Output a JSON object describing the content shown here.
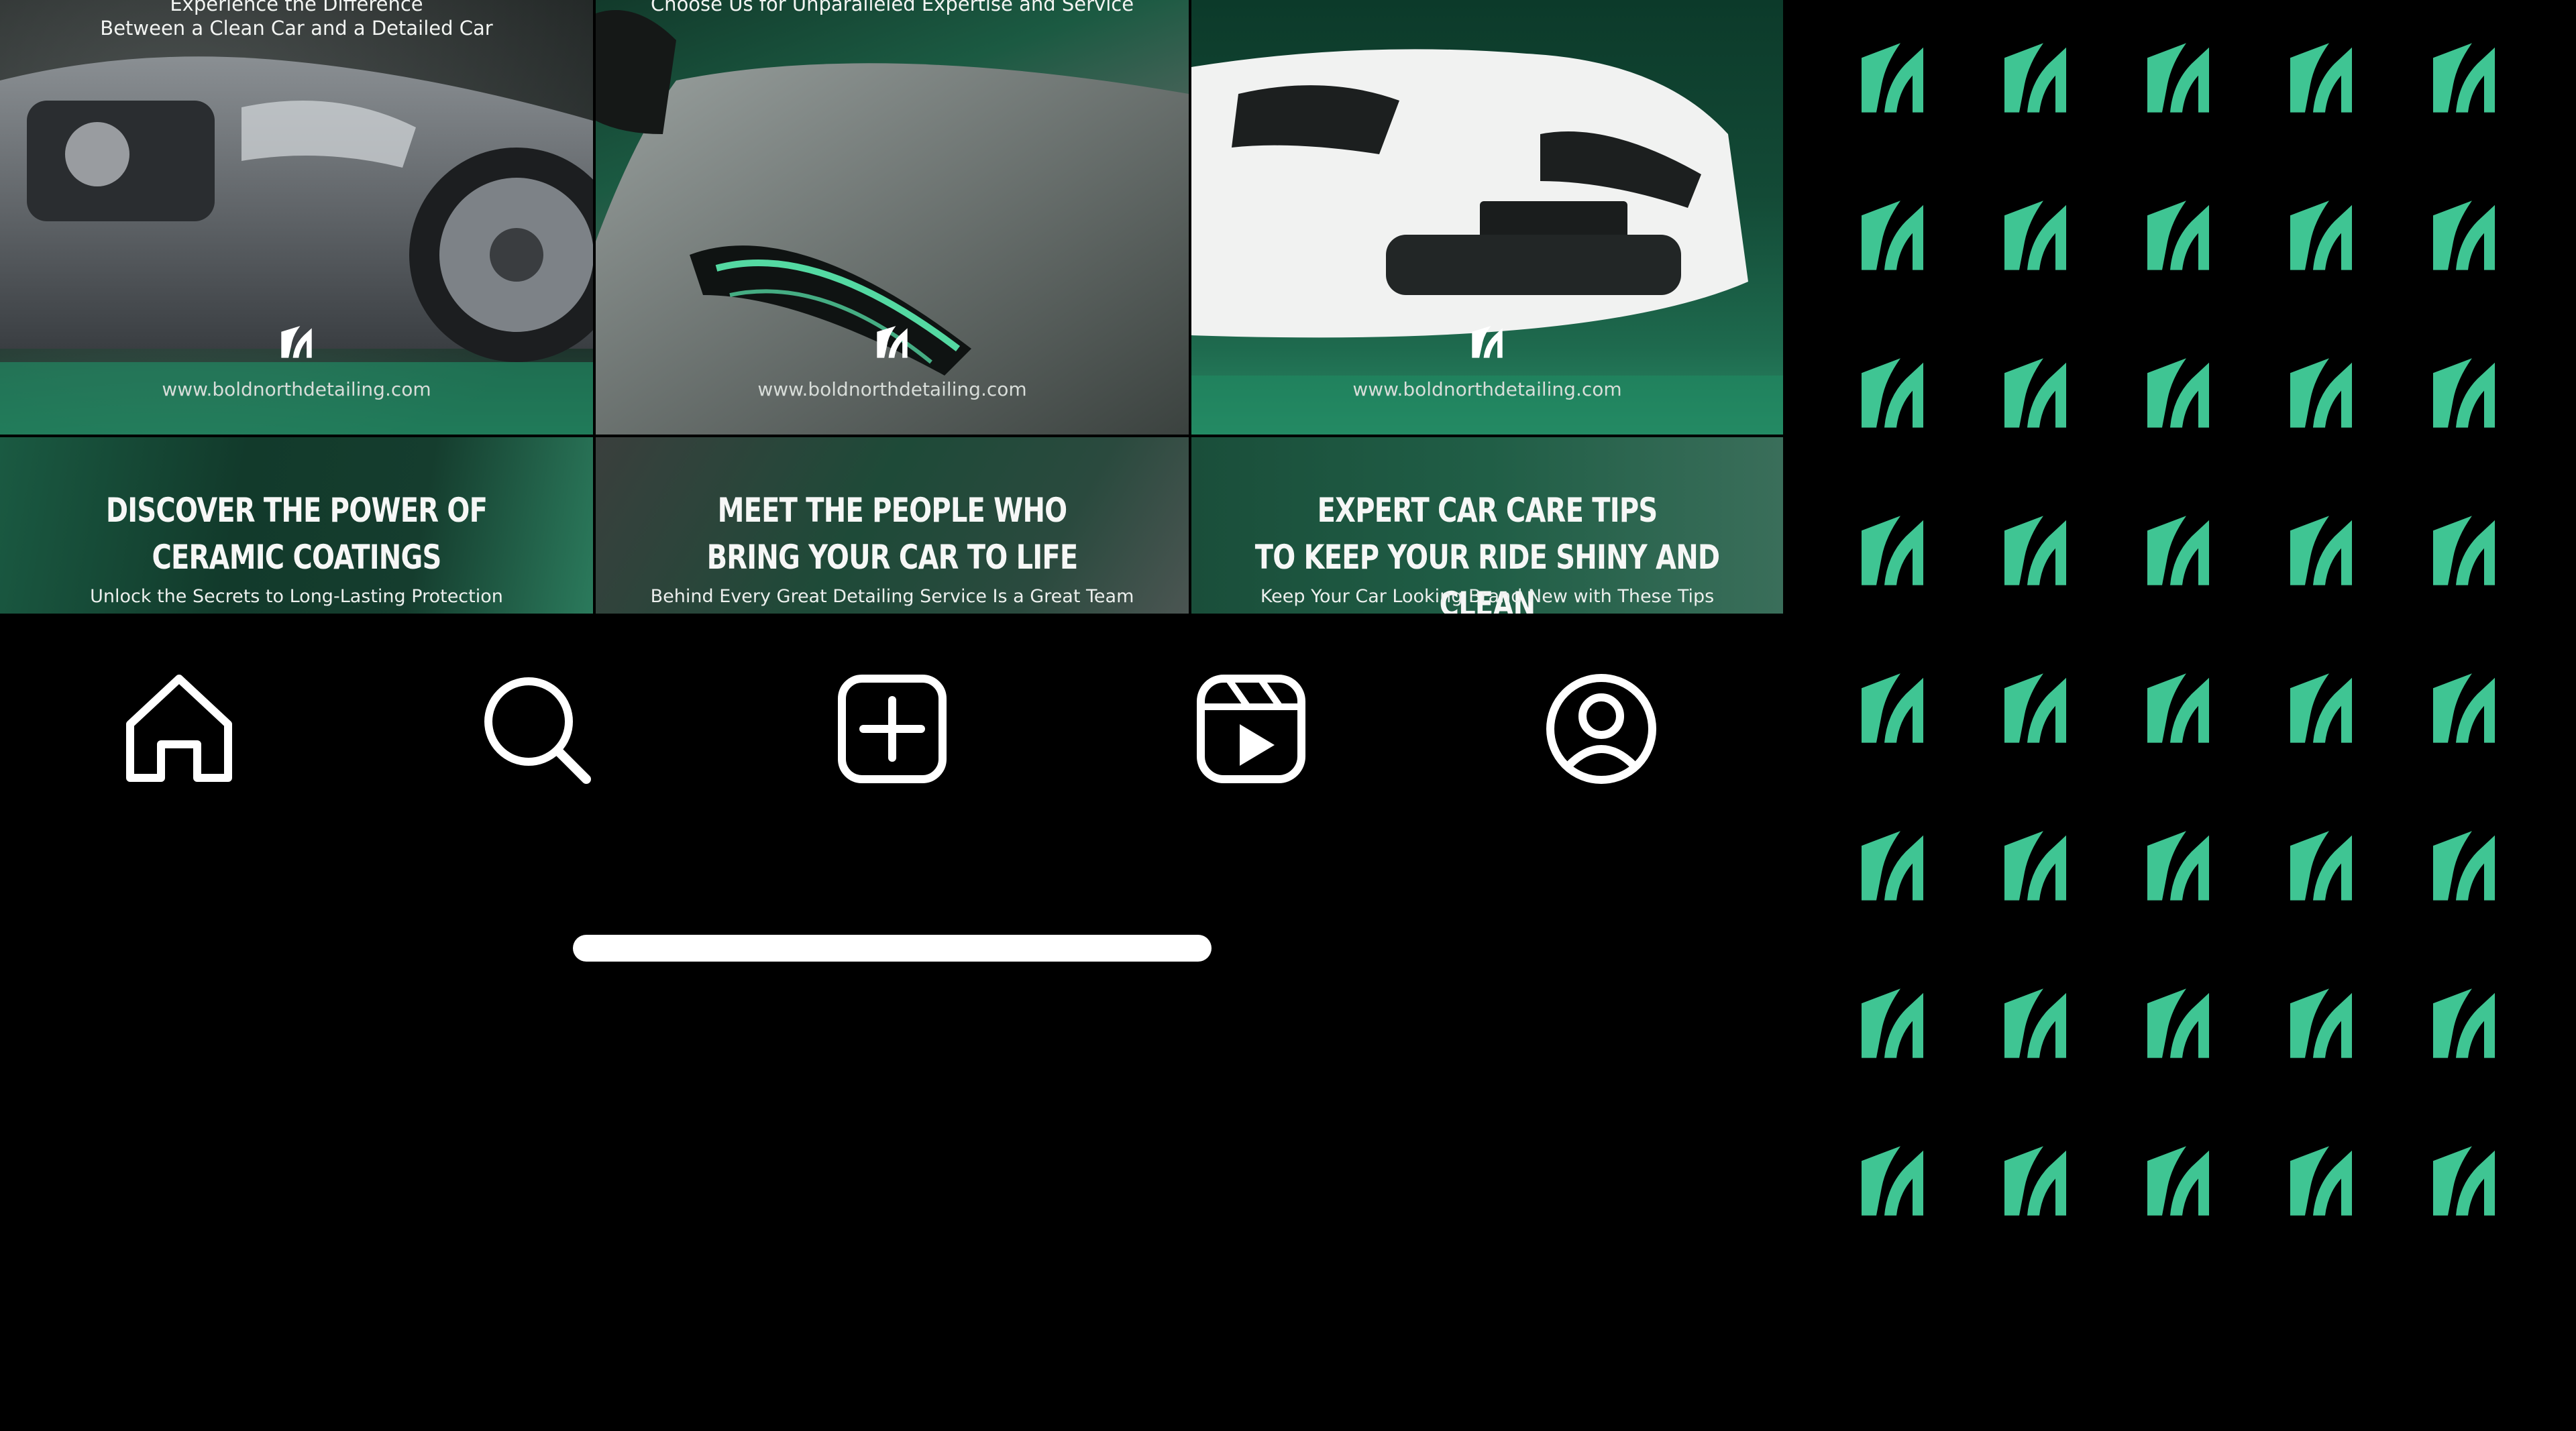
{
  "brand": {
    "accent": "#3fc593",
    "dark_green": "#123a2b",
    "background": "#000000"
  },
  "posts_row1": [
    {
      "top_text_1": "Experience the Difference",
      "top_text_2": "Between a Clean Car and a Detailed Car",
      "url": "www.boldnorthdetailing.com"
    },
    {
      "top_text_1": "Choose Us for Unparalleled Expertise and Service",
      "top_text_2": "",
      "url": "www.boldnorthdetailing.com"
    },
    {
      "top_text_1": "",
      "top_text_2": "",
      "url": "www.boldnorthdetailing.com"
    }
  ],
  "posts_row2": [
    {
      "title_1": "DISCOVER THE POWER OF",
      "title_2": "CERAMIC COATINGS",
      "subtitle": "Unlock the Secrets to Long-Lasting Protection"
    },
    {
      "title_1": "MEET THE PEOPLE WHO",
      "title_2": "BRING YOUR CAR TO LIFE",
      "subtitle": "Behind Every Great Detailing Service Is a Great Team"
    },
    {
      "title_1": "EXPERT CAR CARE TIPS",
      "title_2": "TO KEEP YOUR RIDE SHINY AND CLEAN",
      "subtitle": "Keep Your Car Looking Brand New with These Tips"
    }
  ],
  "nav": [
    {
      "name": "home",
      "icon": "home-icon"
    },
    {
      "name": "search",
      "icon": "search-icon"
    },
    {
      "name": "create",
      "icon": "plus-square-icon"
    },
    {
      "name": "reels",
      "icon": "reels-icon"
    },
    {
      "name": "profile",
      "icon": "profile-icon"
    }
  ],
  "pattern": {
    "icon": "bold-north-logo-icon",
    "columns": 5,
    "rows": 8
  }
}
